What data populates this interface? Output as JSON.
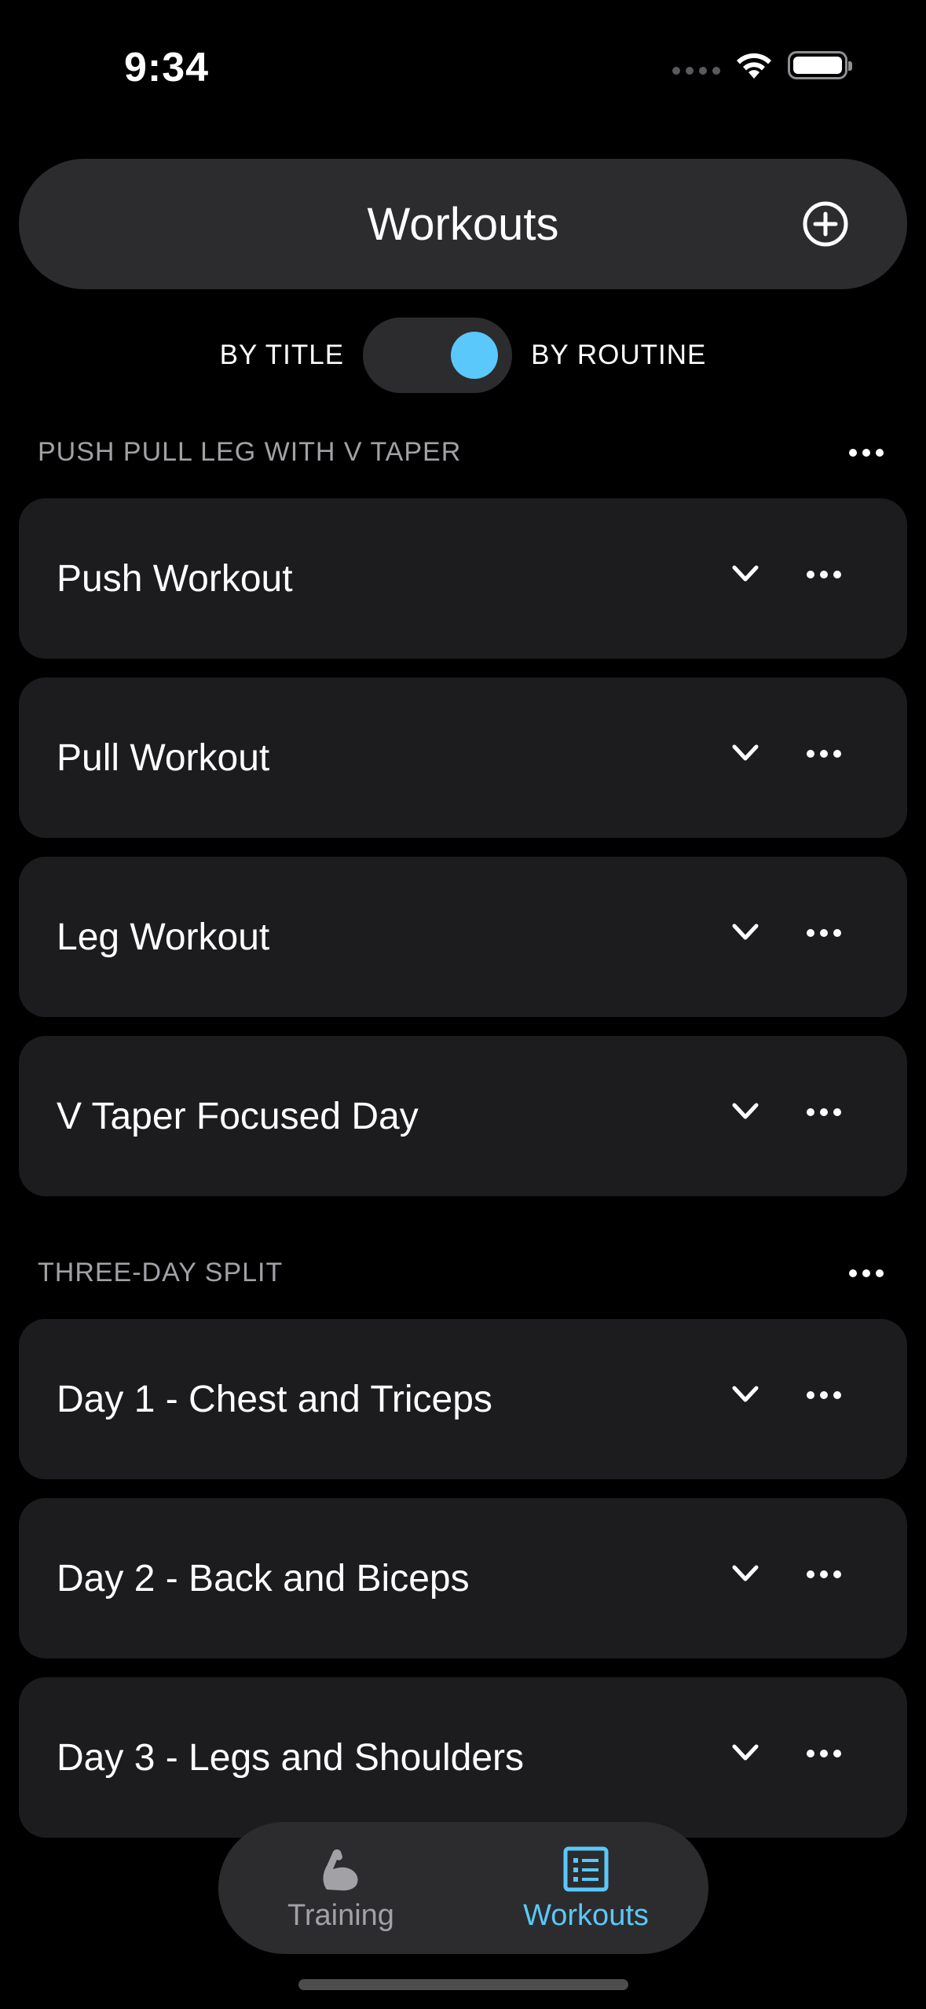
{
  "status_bar": {
    "time": "9:34"
  },
  "header": {
    "title": "Workouts"
  },
  "toggle": {
    "left_label": "BY TITLE",
    "right_label": "BY ROUTINE",
    "selected": "BY ROUTINE"
  },
  "sections": [
    {
      "title": "PUSH PULL LEG WITH V TAPER",
      "workouts": [
        {
          "title": "Push Workout"
        },
        {
          "title": "Pull Workout"
        },
        {
          "title": "Leg Workout"
        },
        {
          "title": "V Taper Focused Day"
        }
      ]
    },
    {
      "title": "THREE-DAY SPLIT",
      "workouts": [
        {
          "title": "Day 1 - Chest and Triceps"
        },
        {
          "title": "Day 2 - Back and Biceps"
        },
        {
          "title": "Day 3 - Legs and Shoulders"
        }
      ]
    }
  ],
  "tabbar": {
    "tabs": [
      {
        "label": "Training",
        "icon": "flexed-arm-icon",
        "active": false
      },
      {
        "label": "Workouts",
        "icon": "list-icon",
        "active": true
      }
    ]
  },
  "colors": {
    "accent": "#5ac8fa",
    "background": "#000000",
    "card": "#1c1c1e",
    "pill": "#2c2c2e",
    "secondary_text": "#a1a1a6"
  }
}
